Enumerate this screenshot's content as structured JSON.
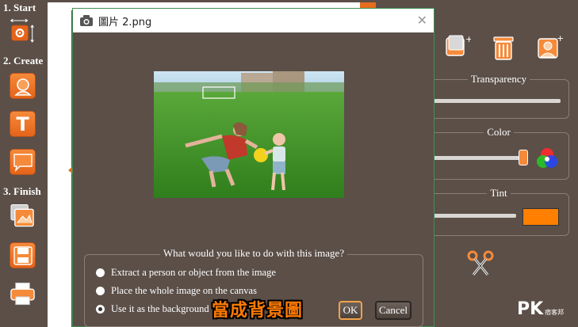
{
  "toolbar": {
    "start_label": "1. Start",
    "create_label": "2. Create",
    "finish_label": "3. Finish"
  },
  "dialog": {
    "title": "圖片 2.png",
    "close_glyph": "✕",
    "question": "What would you like to do with this image?",
    "options": [
      {
        "label": "Extract a person or object from the image",
        "selected": false
      },
      {
        "label": "Place the whole image on the canvas",
        "selected": false
      },
      {
        "label": "Use it as the background",
        "selected": true
      }
    ],
    "caption": "當成背景圖",
    "ok_label": "OK",
    "cancel_label": "Cancel"
  },
  "right_panel": {
    "transparency_label": "Transparency",
    "transparency_value": 1.0,
    "color_label": "Color",
    "color_value": 1.0,
    "tint_label": "Tint",
    "tint_value": 1.0,
    "tint_swatch": "#ff8000"
  },
  "watermark": {
    "main": "PK",
    "sub": "痞客邦"
  },
  "colors": {
    "accent": "#e46d1e",
    "bg": "#5b4f48",
    "dialog_border": "#3f8f54"
  }
}
